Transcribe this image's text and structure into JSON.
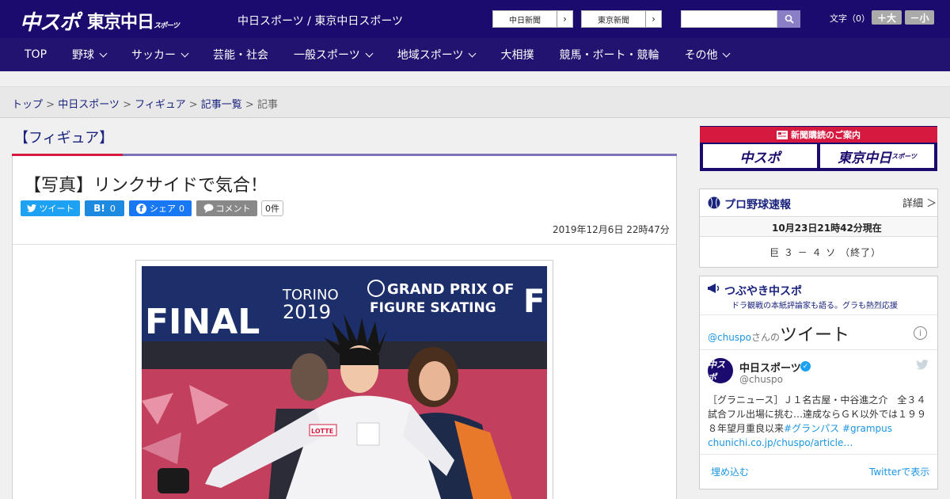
{
  "header": {
    "logo_main": "中スポ",
    "logo_tokyo": "東京中日",
    "logo_tokyo_small": "スポーツ",
    "site_title": "中日スポーツ / 東京中日スポーツ",
    "paper_links": [
      {
        "label": "中日新聞"
      },
      {
        "label": "東京新聞"
      }
    ],
    "search_placeholder": "",
    "font_label": "文字（0）",
    "font_larger": "＋大",
    "font_smaller": "－小"
  },
  "nav": [
    {
      "label": "TOP",
      "has_menu": false
    },
    {
      "label": "野球",
      "has_menu": true
    },
    {
      "label": "サッカー",
      "has_menu": true
    },
    {
      "label": "芸能・社会",
      "has_menu": false
    },
    {
      "label": "一般スポーツ",
      "has_menu": true
    },
    {
      "label": "地域スポーツ",
      "has_menu": true
    },
    {
      "label": "大相撲",
      "has_menu": false
    },
    {
      "label": "競馬・ボート・競輪",
      "has_menu": false
    },
    {
      "label": "その他",
      "has_menu": true
    }
  ],
  "breadcrumb": [
    {
      "label": "トップ"
    },
    {
      "label": "中日スポーツ"
    },
    {
      "label": "フィギュア"
    },
    {
      "label": "記事一覧"
    },
    {
      "label": "記事"
    }
  ],
  "article": {
    "category": "【フィギュア】",
    "title": "【写真】リンクサイドで気合！",
    "date": "2019年12月6日 22時47分",
    "share": {
      "tweet": "ツイート",
      "hatena": "B!",
      "hatena_count": "0",
      "facebook": "シェア",
      "facebook_count": "0",
      "comment": "コメント",
      "comment_count": "0件"
    },
    "photo": {
      "banner_final": "FINAL",
      "banner_torino": "TORINO",
      "banner_year": "2019",
      "banner_gp1": "GRAND PRIX OF",
      "banner_gp2": "FIGURE SKATING",
      "banner_edge": "FI",
      "jacket_sponsor": "LOTTE"
    }
  },
  "sidebar": {
    "subscribe": {
      "heading": "新聞購読のご案内",
      "logo_chuspo": "中スポ",
      "logo_tokyo": "東京中日",
      "logo_tokyo_small": "スポーツ"
    },
    "baseball": {
      "title": "プロ野球速報",
      "more": "詳細 ＞",
      "time": "10月23日21時42分現在",
      "score": "巨 ３ － ４ ソ （終了）"
    },
    "twitter": {
      "title": "つぶやき中スポ",
      "subtitle": "ドラ観戦の本紙評論家も語る。グラも熱烈応援",
      "head_user": "@chuspo",
      "head_suffix": "さんの",
      "head_label": "ツイート",
      "avatar_text": "中スポ",
      "name": "中日スポーツ",
      "handle": "@chuspo",
      "text": "［グラニュース］Ｊ１名古屋・中谷進之介　全３４試合フル出場に挑む…達成ならＧＫ以外では１９９８年望月重良以来",
      "tag1": "#グランパス",
      "tag2": "#grampus",
      "link": "chunichi.co.jp/chuspo/article…",
      "embed": "埋め込む",
      "view": "Twitterで表示"
    }
  },
  "colors": {
    "header_bg": "#1c0b6e",
    "nav_bg": "#21136f",
    "accent_red": "#d6193f",
    "link_blue": "#1a237e",
    "twitter_blue": "#1b95e0"
  }
}
